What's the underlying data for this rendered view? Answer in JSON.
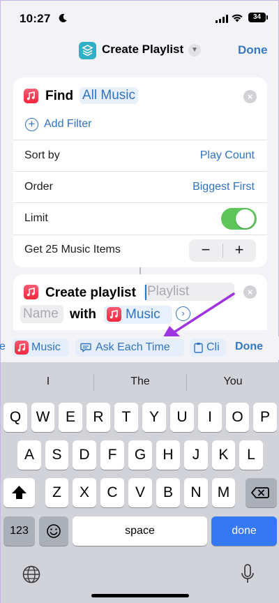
{
  "status_bar": {
    "time": "10:27",
    "battery": "34"
  },
  "nav": {
    "title": "Create Playlist",
    "done_label": "Done"
  },
  "find_action": {
    "label": "Find",
    "source_token": "All Music",
    "add_filter_label": "Add Filter",
    "rows": [
      {
        "label": "Sort by",
        "value": "Play Count"
      },
      {
        "label": "Order",
        "value": "Biggest First"
      },
      {
        "label": "Limit",
        "value": ""
      },
      {
        "label": "Get 25 Music Items",
        "value": ""
      }
    ],
    "limit_enabled": true,
    "stepper": {
      "minus": "−",
      "plus": "+"
    }
  },
  "create_action": {
    "label": "Create playlist",
    "name_placeholder_part1": "Playlist",
    "name_placeholder_part2": "Name",
    "with_label": "with",
    "music_token": "Music"
  },
  "variable_bar": {
    "items": [
      {
        "label": "e",
        "icon": "partial"
      },
      {
        "label": "Music",
        "icon": "music-app-icon"
      },
      {
        "label": "Ask Each Time",
        "icon": "speech-bubble-icon"
      },
      {
        "label": "Cli",
        "icon": "clipboard-icon"
      }
    ],
    "done_label": "Done"
  },
  "keyboard": {
    "suggestions": [
      "I",
      "The",
      "You"
    ],
    "row1": [
      "Q",
      "W",
      "E",
      "R",
      "T",
      "Y",
      "U",
      "I",
      "O",
      "P"
    ],
    "row2": [
      "A",
      "S",
      "D",
      "F",
      "G",
      "H",
      "J",
      "K",
      "L"
    ],
    "row3": [
      "Z",
      "X",
      "C",
      "V",
      "B",
      "N",
      "M"
    ],
    "numbers_label": "123",
    "space_label": "space",
    "done_label": "done"
  },
  "colors": {
    "accent": "#2f73c4",
    "toggle_on": "#5cc65b",
    "music_red": "#f0283c",
    "annotation_arrow": "#a033e0"
  }
}
